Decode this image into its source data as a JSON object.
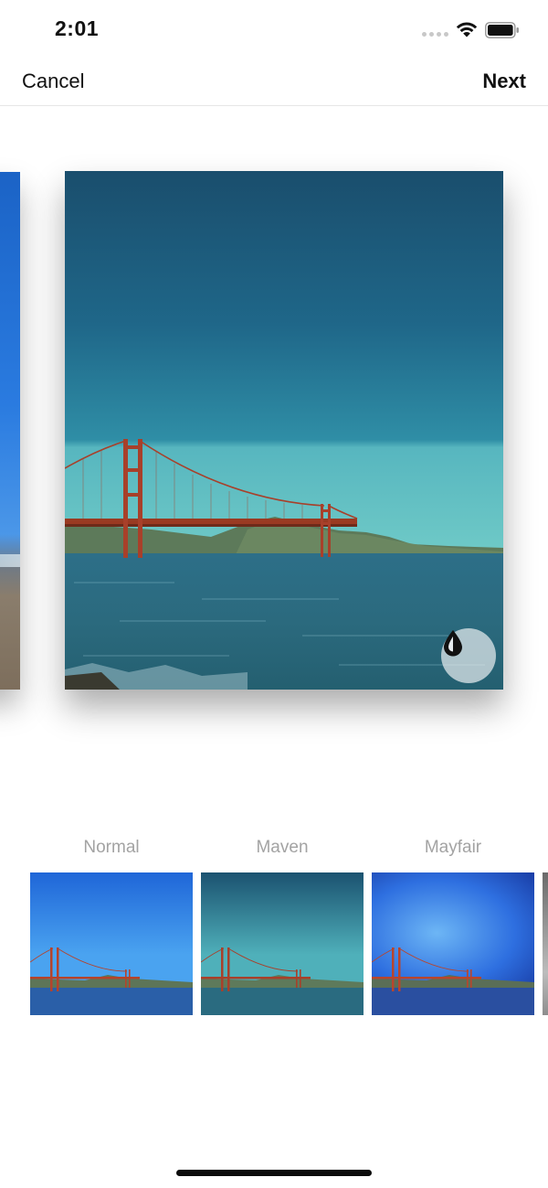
{
  "status_bar": {
    "time": "2:01",
    "icons": [
      "signal-dots-icon",
      "wifi-icon",
      "battery-icon"
    ]
  },
  "nav": {
    "cancel_label": "Cancel",
    "next_label": "Next"
  },
  "editor": {
    "filter_toggle_icon": "droplet-icon"
  },
  "filters": [
    {
      "label": "Normal",
      "tone": "#2f7fe0"
    },
    {
      "label": "Maven",
      "tone": "#2a7d93"
    },
    {
      "label": "Mayfair",
      "tone": "#2b5fd8"
    }
  ],
  "colors": {
    "text": "#111111",
    "filter_label": "#a3a3a3",
    "divider": "#e6e6e6"
  }
}
